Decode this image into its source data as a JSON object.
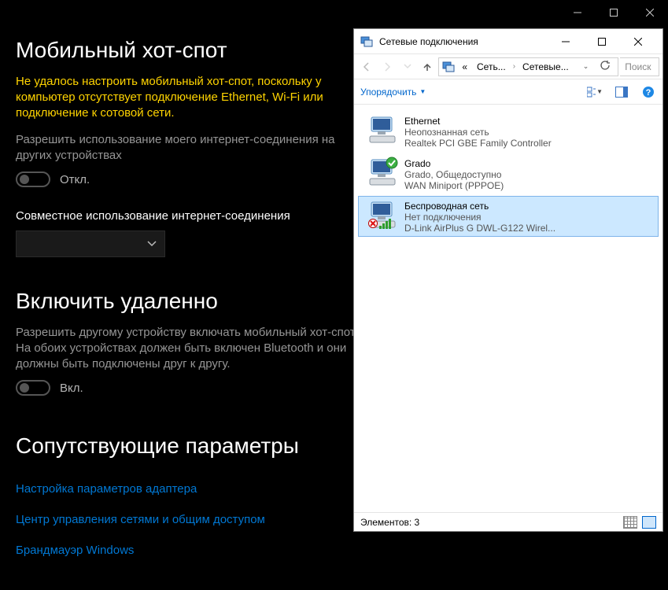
{
  "settings": {
    "title": "Мобильный хот-спот",
    "warning": "Не удалось настроить мобильный хот-спот, поскольку у компьютер отсутствует подключение Ethernet, Wi-Fi или подключение к сотовой сети.",
    "share_desc": "Разрешить использование моего интернет-соединения на других устройствах",
    "toggle1_label": "Откл.",
    "combo_label": "Совместное использование интернет-соединения",
    "remote_title": "Включить удаленно",
    "remote_desc": "Разрешить другому устройству включать мобильный хот-спот. На обоих устройствах должен быть включен Bluetooth и они должны быть подключены друг к другу.",
    "toggle2_label": "Вкл.",
    "related_title": "Сопутствующие параметры",
    "links": {
      "adapter": "Настройка параметров адаптера",
      "sharing": "Центр управления сетями и общим доступом",
      "firewall": "Брандмауэр Windows"
    }
  },
  "win": {
    "title": "Сетевые подключения",
    "breadcrumb": {
      "lead": "«",
      "root": "Сеть...",
      "current": "Сетевые..."
    },
    "search_placeholder": "Поиск",
    "organize_label": "Упорядочить",
    "status": "Элементов: 3",
    "connections": [
      {
        "name": "Ethernet",
        "status": "Неопознанная сеть",
        "device": "Realtek PCI GBE Family Controller",
        "selected": false,
        "overlay": "none"
      },
      {
        "name": "Grado",
        "status": "Grado, Общедоступно",
        "device": "WAN Miniport (PPPOE)",
        "selected": false,
        "overlay": "check"
      },
      {
        "name": "Беспроводная сеть",
        "status": "Нет подключения",
        "device": "D-Link AirPlus G DWL-G122 Wirel...",
        "selected": true,
        "overlay": "wifi-cross"
      }
    ]
  }
}
